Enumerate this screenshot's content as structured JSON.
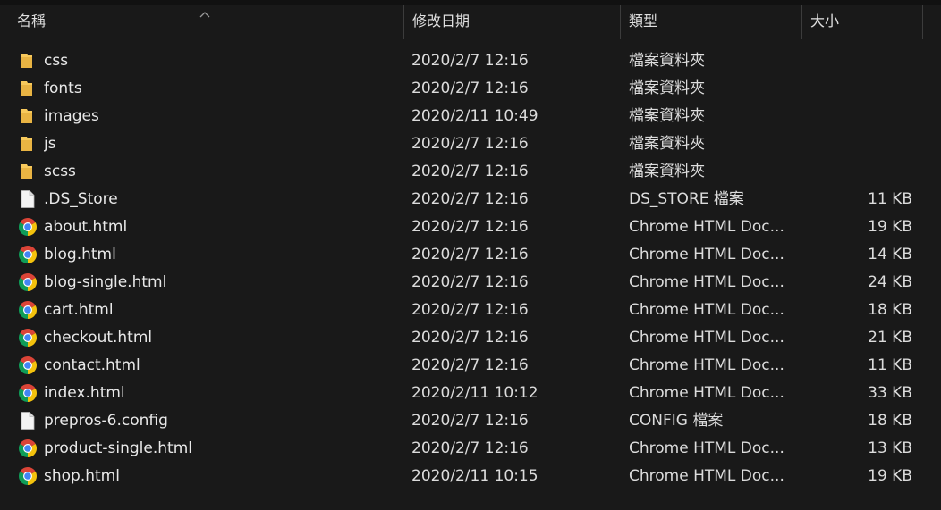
{
  "header": {
    "name": "名稱",
    "date_modified": "修改日期",
    "type": "類型",
    "size": "大小"
  },
  "files": [
    {
      "name": "css",
      "icon": "folder-icon",
      "date": "2020/2/7 12:16",
      "type": "檔案資料夾",
      "size": ""
    },
    {
      "name": "fonts",
      "icon": "folder-icon",
      "date": "2020/2/7 12:16",
      "type": "檔案資料夾",
      "size": ""
    },
    {
      "name": "images",
      "icon": "folder-icon",
      "date": "2020/2/11 10:49",
      "type": "檔案資料夾",
      "size": ""
    },
    {
      "name": "js",
      "icon": "folder-icon",
      "date": "2020/2/7 12:16",
      "type": "檔案資料夾",
      "size": ""
    },
    {
      "name": "scss",
      "icon": "folder-icon",
      "date": "2020/2/7 12:16",
      "type": "檔案資料夾",
      "size": ""
    },
    {
      "name": ".DS_Store",
      "icon": "file-icon",
      "date": "2020/2/7 12:16",
      "type": "DS_STORE 檔案",
      "size": "11 KB"
    },
    {
      "name": "about.html",
      "icon": "chrome-icon",
      "date": "2020/2/7 12:16",
      "type": "Chrome HTML Doc...",
      "size": "19 KB"
    },
    {
      "name": "blog.html",
      "icon": "chrome-icon",
      "date": "2020/2/7 12:16",
      "type": "Chrome HTML Doc...",
      "size": "14 KB"
    },
    {
      "name": "blog-single.html",
      "icon": "chrome-icon",
      "date": "2020/2/7 12:16",
      "type": "Chrome HTML Doc...",
      "size": "24 KB"
    },
    {
      "name": "cart.html",
      "icon": "chrome-icon",
      "date": "2020/2/7 12:16",
      "type": "Chrome HTML Doc...",
      "size": "18 KB"
    },
    {
      "name": "checkout.html",
      "icon": "chrome-icon",
      "date": "2020/2/7 12:16",
      "type": "Chrome HTML Doc...",
      "size": "21 KB"
    },
    {
      "name": "contact.html",
      "icon": "chrome-icon",
      "date": "2020/2/7 12:16",
      "type": "Chrome HTML Doc...",
      "size": "11 KB"
    },
    {
      "name": "index.html",
      "icon": "chrome-icon",
      "date": "2020/2/11 10:12",
      "type": "Chrome HTML Doc...",
      "size": "33 KB"
    },
    {
      "name": "prepros-6.config",
      "icon": "file-icon",
      "date": "2020/2/7 12:16",
      "type": "CONFIG 檔案",
      "size": "18 KB"
    },
    {
      "name": "product-single.html",
      "icon": "chrome-icon",
      "date": "2020/2/7 12:16",
      "type": "Chrome HTML Doc...",
      "size": "13 KB"
    },
    {
      "name": "shop.html",
      "icon": "chrome-icon",
      "date": "2020/2/11 10:15",
      "type": "Chrome HTML Doc...",
      "size": "19 KB"
    }
  ],
  "colors": {
    "background": "#191919",
    "text": "#e8e8e8",
    "folder": "#f7c95c",
    "chrome_red": "#db4437",
    "chrome_yellow": "#f4c20d",
    "chrome_green": "#0f9d58",
    "chrome_blue": "#4285f4"
  }
}
